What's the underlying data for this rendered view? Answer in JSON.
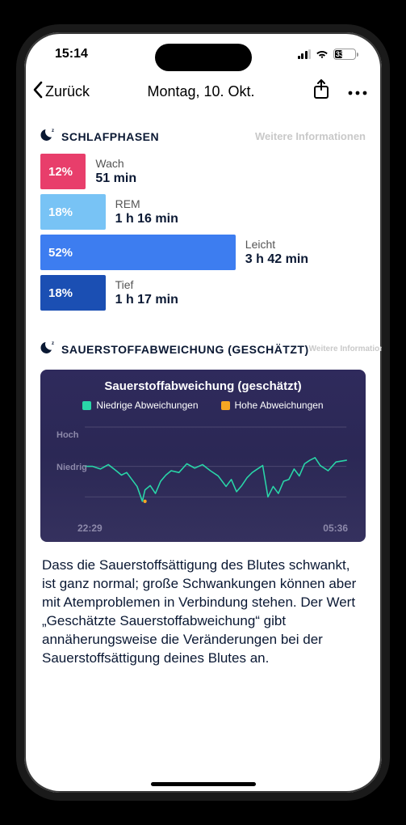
{
  "status": {
    "time": "15:14",
    "battery_pct": "33"
  },
  "nav": {
    "back": "Zurück",
    "title": "Montag, 10. Okt."
  },
  "sleep_phases": {
    "title": "SCHLAFPHASEN",
    "more": "Weitere Informationen",
    "phases": [
      {
        "pct": "12%",
        "label": "Wach",
        "duration": "51 min",
        "color": "#e83e6b",
        "width_pct": 14
      },
      {
        "pct": "18%",
        "label": "REM",
        "duration": "1 h 16 min",
        "color": "#78c3f5",
        "width_pct": 20
      },
      {
        "pct": "52%",
        "label": "Leicht",
        "duration": "3 h 42 min",
        "color": "#3d7df0",
        "width_pct": 60
      },
      {
        "pct": "18%",
        "label": "Tief",
        "duration": "1 h 17 min",
        "color": "#1b4fb3",
        "width_pct": 20
      }
    ]
  },
  "oxygen": {
    "section_title": "SAUERSTOFFABWEICHUNG (GESCHÄTZT)",
    "more": "Weitere Informationen",
    "card_title": "Sauerstoffabweichung (geschätzt)",
    "legend_low": "Niedrige Abweichungen",
    "legend_high": "Hohe Abweichungen",
    "axis_high": "Hoch",
    "axis_low": "Niedrig",
    "time_start": "22:29",
    "time_end": "05:36",
    "desc": "Dass die Sauerstoffsättigung des Blutes schwankt, ist ganz normal; große Schwankungen können aber mit Atemproblemen in Verbindung stehen. Der Wert „Geschätzte Sauerstoffabweichung“ gibt annäherungsweise die Veränderungen bei der Sauerstoffsättigung deines Blutes an."
  },
  "chart_data": {
    "type": "line",
    "title": "Sauerstoffabweichung (geschätzt)",
    "xlabel": "",
    "ylabel": "",
    "y_levels": [
      "Niedrig",
      "Hoch"
    ],
    "x_range": [
      "22:29",
      "05:36"
    ],
    "series": [
      {
        "name": "Niedrige Abweichungen",
        "color": "#29d6a8",
        "x": [
          0,
          3,
          6,
          9,
          12,
          14,
          16,
          18,
          20,
          22,
          23,
          25,
          27,
          29,
          31,
          33,
          36,
          39,
          42,
          45,
          48,
          51,
          54,
          56,
          58,
          60,
          62,
          64,
          66,
          68,
          70,
          72,
          74,
          76,
          78,
          80,
          82,
          84,
          86,
          88,
          90,
          93,
          96,
          100
        ],
        "y": [
          55,
          55,
          52,
          57,
          50,
          45,
          48,
          40,
          32,
          15,
          28,
          33,
          24,
          38,
          45,
          50,
          48,
          58,
          53,
          57,
          50,
          44,
          32,
          40,
          26,
          33,
          42,
          48,
          52,
          56,
          20,
          32,
          24,
          38,
          40,
          52,
          44,
          58,
          62,
          65,
          56,
          50,
          60,
          62
        ]
      },
      {
        "name": "Hohe Abweichungen",
        "color": "#f5a623",
        "x": [
          23
        ],
        "y": [
          15
        ]
      }
    ],
    "ylim": [
      0,
      100
    ],
    "grid_y_positions": [
      20,
      55,
      100
    ]
  }
}
